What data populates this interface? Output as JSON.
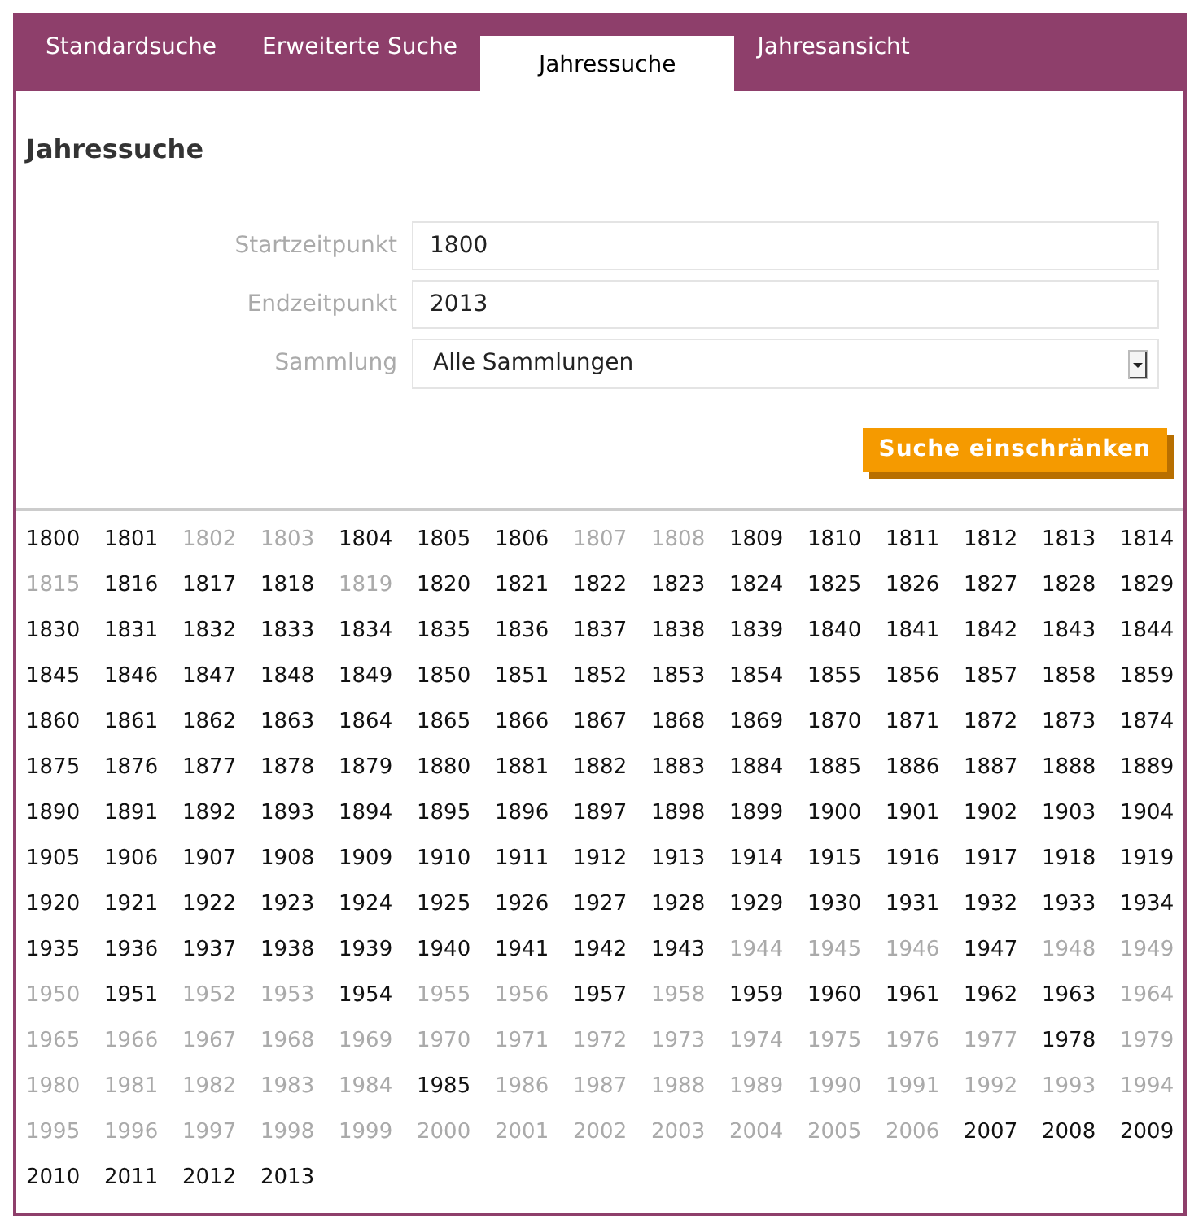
{
  "tabs": [
    {
      "label": "Standardsuche",
      "selected": false
    },
    {
      "label": "Erweiterte Suche",
      "selected": false
    },
    {
      "label": "Jahressuche",
      "selected": true
    },
    {
      "label": "Jahresansicht",
      "selected": false
    }
  ],
  "heading": "Jahressuche",
  "form": [
    {
      "kind": "input",
      "label": "Startzeitpunkt",
      "value": "1800"
    },
    {
      "kind": "input",
      "label": "Endzeitpunkt",
      "value": "2013"
    },
    {
      "kind": "select",
      "label": "Sammlung",
      "value": "Alle Sammlungen"
    }
  ],
  "submit_button": "Suche einschränken",
  "years": [
    {
      "label": "1800",
      "disabled": false
    },
    {
      "label": "1801",
      "disabled": false
    },
    {
      "label": "1802",
      "disabled": true
    },
    {
      "label": "1803",
      "disabled": true
    },
    {
      "label": "1804",
      "disabled": false
    },
    {
      "label": "1805",
      "disabled": false
    },
    {
      "label": "1806",
      "disabled": false
    },
    {
      "label": "1807",
      "disabled": true
    },
    {
      "label": "1808",
      "disabled": true
    },
    {
      "label": "1809",
      "disabled": false
    },
    {
      "label": "1810",
      "disabled": false
    },
    {
      "label": "1811",
      "disabled": false
    },
    {
      "label": "1812",
      "disabled": false
    },
    {
      "label": "1813",
      "disabled": false
    },
    {
      "label": "1814",
      "disabled": false
    },
    {
      "label": "1815",
      "disabled": true
    },
    {
      "label": "1816",
      "disabled": false
    },
    {
      "label": "1817",
      "disabled": false
    },
    {
      "label": "1818",
      "disabled": false
    },
    {
      "label": "1819",
      "disabled": true
    },
    {
      "label": "1820",
      "disabled": false
    },
    {
      "label": "1821",
      "disabled": false
    },
    {
      "label": "1822",
      "disabled": false
    },
    {
      "label": "1823",
      "disabled": false
    },
    {
      "label": "1824",
      "disabled": false
    },
    {
      "label": "1825",
      "disabled": false
    },
    {
      "label": "1826",
      "disabled": false
    },
    {
      "label": "1827",
      "disabled": false
    },
    {
      "label": "1828",
      "disabled": false
    },
    {
      "label": "1829",
      "disabled": false
    },
    {
      "label": "1830",
      "disabled": false
    },
    {
      "label": "1831",
      "disabled": false
    },
    {
      "label": "1832",
      "disabled": false
    },
    {
      "label": "1833",
      "disabled": false
    },
    {
      "label": "1834",
      "disabled": false
    },
    {
      "label": "1835",
      "disabled": false
    },
    {
      "label": "1836",
      "disabled": false
    },
    {
      "label": "1837",
      "disabled": false
    },
    {
      "label": "1838",
      "disabled": false
    },
    {
      "label": "1839",
      "disabled": false
    },
    {
      "label": "1840",
      "disabled": false
    },
    {
      "label": "1841",
      "disabled": false
    },
    {
      "label": "1842",
      "disabled": false
    },
    {
      "label": "1843",
      "disabled": false
    },
    {
      "label": "1844",
      "disabled": false
    },
    {
      "label": "1845",
      "disabled": false
    },
    {
      "label": "1846",
      "disabled": false
    },
    {
      "label": "1847",
      "disabled": false
    },
    {
      "label": "1848",
      "disabled": false
    },
    {
      "label": "1849",
      "disabled": false
    },
    {
      "label": "1850",
      "disabled": false
    },
    {
      "label": "1851",
      "disabled": false
    },
    {
      "label": "1852",
      "disabled": false
    },
    {
      "label": "1853",
      "disabled": false
    },
    {
      "label": "1854",
      "disabled": false
    },
    {
      "label": "1855",
      "disabled": false
    },
    {
      "label": "1856",
      "disabled": false
    },
    {
      "label": "1857",
      "disabled": false
    },
    {
      "label": "1858",
      "disabled": false
    },
    {
      "label": "1859",
      "disabled": false
    },
    {
      "label": "1860",
      "disabled": false
    },
    {
      "label": "1861",
      "disabled": false
    },
    {
      "label": "1862",
      "disabled": false
    },
    {
      "label": "1863",
      "disabled": false
    },
    {
      "label": "1864",
      "disabled": false
    },
    {
      "label": "1865",
      "disabled": false
    },
    {
      "label": "1866",
      "disabled": false
    },
    {
      "label": "1867",
      "disabled": false
    },
    {
      "label": "1868",
      "disabled": false
    },
    {
      "label": "1869",
      "disabled": false
    },
    {
      "label": "1870",
      "disabled": false
    },
    {
      "label": "1871",
      "disabled": false
    },
    {
      "label": "1872",
      "disabled": false
    },
    {
      "label": "1873",
      "disabled": false
    },
    {
      "label": "1874",
      "disabled": false
    },
    {
      "label": "1875",
      "disabled": false
    },
    {
      "label": "1876",
      "disabled": false
    },
    {
      "label": "1877",
      "disabled": false
    },
    {
      "label": "1878",
      "disabled": false
    },
    {
      "label": "1879",
      "disabled": false
    },
    {
      "label": "1880",
      "disabled": false
    },
    {
      "label": "1881",
      "disabled": false
    },
    {
      "label": "1882",
      "disabled": false
    },
    {
      "label": "1883",
      "disabled": false
    },
    {
      "label": "1884",
      "disabled": false
    },
    {
      "label": "1885",
      "disabled": false
    },
    {
      "label": "1886",
      "disabled": false
    },
    {
      "label": "1887",
      "disabled": false
    },
    {
      "label": "1888",
      "disabled": false
    },
    {
      "label": "1889",
      "disabled": false
    },
    {
      "label": "1890",
      "disabled": false
    },
    {
      "label": "1891",
      "disabled": false
    },
    {
      "label": "1892",
      "disabled": false
    },
    {
      "label": "1893",
      "disabled": false
    },
    {
      "label": "1894",
      "disabled": false
    },
    {
      "label": "1895",
      "disabled": false
    },
    {
      "label": "1896",
      "disabled": false
    },
    {
      "label": "1897",
      "disabled": false
    },
    {
      "label": "1898",
      "disabled": false
    },
    {
      "label": "1899",
      "disabled": false
    },
    {
      "label": "1900",
      "disabled": false
    },
    {
      "label": "1901",
      "disabled": false
    },
    {
      "label": "1902",
      "disabled": false
    },
    {
      "label": "1903",
      "disabled": false
    },
    {
      "label": "1904",
      "disabled": false
    },
    {
      "label": "1905",
      "disabled": false
    },
    {
      "label": "1906",
      "disabled": false
    },
    {
      "label": "1907",
      "disabled": false
    },
    {
      "label": "1908",
      "disabled": false
    },
    {
      "label": "1909",
      "disabled": false
    },
    {
      "label": "1910",
      "disabled": false
    },
    {
      "label": "1911",
      "disabled": false
    },
    {
      "label": "1912",
      "disabled": false
    },
    {
      "label": "1913",
      "disabled": false
    },
    {
      "label": "1914",
      "disabled": false
    },
    {
      "label": "1915",
      "disabled": false
    },
    {
      "label": "1916",
      "disabled": false
    },
    {
      "label": "1917",
      "disabled": false
    },
    {
      "label": "1918",
      "disabled": false
    },
    {
      "label": "1919",
      "disabled": false
    },
    {
      "label": "1920",
      "disabled": false
    },
    {
      "label": "1921",
      "disabled": false
    },
    {
      "label": "1922",
      "disabled": false
    },
    {
      "label": "1923",
      "disabled": false
    },
    {
      "label": "1924",
      "disabled": false
    },
    {
      "label": "1925",
      "disabled": false
    },
    {
      "label": "1926",
      "disabled": false
    },
    {
      "label": "1927",
      "disabled": false
    },
    {
      "label": "1928",
      "disabled": false
    },
    {
      "label": "1929",
      "disabled": false
    },
    {
      "label": "1930",
      "disabled": false
    },
    {
      "label": "1931",
      "disabled": false
    },
    {
      "label": "1932",
      "disabled": false
    },
    {
      "label": "1933",
      "disabled": false
    },
    {
      "label": "1934",
      "disabled": false
    },
    {
      "label": "1935",
      "disabled": false
    },
    {
      "label": "1936",
      "disabled": false
    },
    {
      "label": "1937",
      "disabled": false
    },
    {
      "label": "1938",
      "disabled": false
    },
    {
      "label": "1939",
      "disabled": false
    },
    {
      "label": "1940",
      "disabled": false
    },
    {
      "label": "1941",
      "disabled": false
    },
    {
      "label": "1942",
      "disabled": false
    },
    {
      "label": "1943",
      "disabled": false
    },
    {
      "label": "1944",
      "disabled": true
    },
    {
      "label": "1945",
      "disabled": true
    },
    {
      "label": "1946",
      "disabled": true
    },
    {
      "label": "1947",
      "disabled": false
    },
    {
      "label": "1948",
      "disabled": true
    },
    {
      "label": "1949",
      "disabled": true
    },
    {
      "label": "1950",
      "disabled": true
    },
    {
      "label": "1951",
      "disabled": false
    },
    {
      "label": "1952",
      "disabled": true
    },
    {
      "label": "1953",
      "disabled": true
    },
    {
      "label": "1954",
      "disabled": false
    },
    {
      "label": "1955",
      "disabled": true
    },
    {
      "label": "1956",
      "disabled": true
    },
    {
      "label": "1957",
      "disabled": false
    },
    {
      "label": "1958",
      "disabled": true
    },
    {
      "label": "1959",
      "disabled": false
    },
    {
      "label": "1960",
      "disabled": false
    },
    {
      "label": "1961",
      "disabled": false
    },
    {
      "label": "1962",
      "disabled": false
    },
    {
      "label": "1963",
      "disabled": false
    },
    {
      "label": "1964",
      "disabled": true
    },
    {
      "label": "1965",
      "disabled": true
    },
    {
      "label": "1966",
      "disabled": true
    },
    {
      "label": "1967",
      "disabled": true
    },
    {
      "label": "1968",
      "disabled": true
    },
    {
      "label": "1969",
      "disabled": true
    },
    {
      "label": "1970",
      "disabled": true
    },
    {
      "label": "1971",
      "disabled": true
    },
    {
      "label": "1972",
      "disabled": true
    },
    {
      "label": "1973",
      "disabled": true
    },
    {
      "label": "1974",
      "disabled": true
    },
    {
      "label": "1975",
      "disabled": true
    },
    {
      "label": "1976",
      "disabled": true
    },
    {
      "label": "1977",
      "disabled": true
    },
    {
      "label": "1978",
      "disabled": false
    },
    {
      "label": "1979",
      "disabled": true
    },
    {
      "label": "1980",
      "disabled": true
    },
    {
      "label": "1981",
      "disabled": true
    },
    {
      "label": "1982",
      "disabled": true
    },
    {
      "label": "1983",
      "disabled": true
    },
    {
      "label": "1984",
      "disabled": true
    },
    {
      "label": "1985",
      "disabled": false
    },
    {
      "label": "1986",
      "disabled": true
    },
    {
      "label": "1987",
      "disabled": true
    },
    {
      "label": "1988",
      "disabled": true
    },
    {
      "label": "1989",
      "disabled": true
    },
    {
      "label": "1990",
      "disabled": true
    },
    {
      "label": "1991",
      "disabled": true
    },
    {
      "label": "1992",
      "disabled": true
    },
    {
      "label": "1993",
      "disabled": true
    },
    {
      "label": "1994",
      "disabled": true
    },
    {
      "label": "1995",
      "disabled": true
    },
    {
      "label": "1996",
      "disabled": true
    },
    {
      "label": "1997",
      "disabled": true
    },
    {
      "label": "1998",
      "disabled": true
    },
    {
      "label": "1999",
      "disabled": true
    },
    {
      "label": "2000",
      "disabled": true
    },
    {
      "label": "2001",
      "disabled": true
    },
    {
      "label": "2002",
      "disabled": true
    },
    {
      "label": "2003",
      "disabled": true
    },
    {
      "label": "2004",
      "disabled": true
    },
    {
      "label": "2005",
      "disabled": true
    },
    {
      "label": "2006",
      "disabled": true
    },
    {
      "label": "2007",
      "disabled": false
    },
    {
      "label": "2008",
      "disabled": false
    },
    {
      "label": "2009",
      "disabled": false
    },
    {
      "label": "2010",
      "disabled": false
    },
    {
      "label": "2011",
      "disabled": false
    },
    {
      "label": "2012",
      "disabled": false
    },
    {
      "label": "2013",
      "disabled": false
    }
  ]
}
